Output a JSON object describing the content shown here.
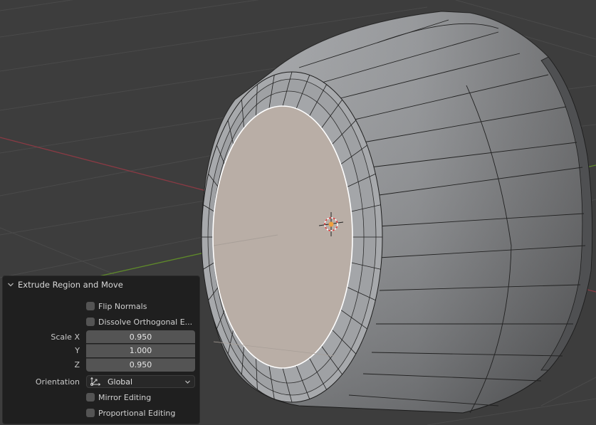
{
  "colors": {
    "viewport_bg": "#3d3d3d",
    "grid": "#484848",
    "x_axis": "#8c3a45",
    "y_axis": "#5f8a2a",
    "mesh_face": "#a3a5a8",
    "mesh_side_light": "#9a9c9f",
    "mesh_side_dark": "#6b6c6e",
    "selected_face": "#b8ada5",
    "panel_bg": "#1f1f1f",
    "field_bg": "#545454"
  },
  "viewport": {
    "cursor_icon": "3d-cursor-icon"
  },
  "operator_panel": {
    "title": "Extrude Region and Move",
    "collapse_icon": "chevron-down-icon",
    "checkboxes_top": [
      {
        "label": "Flip Normals",
        "checked": false
      },
      {
        "label": "Dissolve Orthogonal E...",
        "checked": false
      }
    ],
    "scale": {
      "label_x": "Scale X",
      "label_y": "Y",
      "label_z": "Z",
      "x": "0.950",
      "y": "1.000",
      "z": "0.950"
    },
    "orientation": {
      "label": "Orientation",
      "value": "Global",
      "icon": "orientation-global-icon"
    },
    "checkboxes_bottom": [
      {
        "label": "Mirror Editing",
        "checked": false
      },
      {
        "label": "Proportional Editing",
        "checked": false
      }
    ]
  }
}
